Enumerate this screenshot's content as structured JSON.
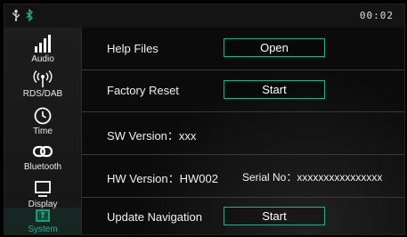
{
  "status": {
    "time": "00:02",
    "icons": [
      "usb-icon",
      "bluetooth-icon"
    ],
    "accent_color": "#1fb48a"
  },
  "sidebar": {
    "items": [
      {
        "label": "Audio",
        "icon": "equalizer-icon"
      },
      {
        "label": "RDS/DAB",
        "icon": "antenna-icon"
      },
      {
        "label": "Time",
        "icon": "clock-icon"
      },
      {
        "label": "Bluetooth",
        "icon": "bluetooth-link-icon"
      },
      {
        "label": "Display",
        "icon": "monitor-icon"
      },
      {
        "label": "System",
        "icon": "system-icon",
        "active": true
      }
    ]
  },
  "settings": {
    "help_files": {
      "label": "Help Files",
      "button": "Open"
    },
    "factory_reset": {
      "label": "Factory Reset",
      "button": "Start"
    },
    "sw_version": "SW Version：xxx",
    "hw_version": "HW Version：HW002",
    "serial_no": "Serial No：xxxxxxxxxxxxxxxx",
    "update_navigation": {
      "label": "Update Navigation",
      "button": "Start"
    }
  }
}
